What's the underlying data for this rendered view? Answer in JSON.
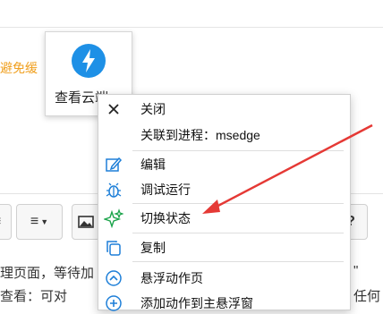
{
  "background": {
    "orange_text": "避免缓",
    "body_line1": "理页面，等待加",
    "body_line2": "查看：可对",
    "body_right1": "\"",
    "body_right2": "任何"
  },
  "toolbar": {
    "list_icon": "≡",
    "align_icon": "≡",
    "image_icon": "image-icon",
    "help_label": "?"
  },
  "tooltip": {
    "label": "查看云端",
    "icon": "lightning-bolt-icon",
    "accent": "#1e90e6"
  },
  "menu": {
    "items": [
      {
        "label": "关闭",
        "icon": "close-icon"
      },
      {
        "label": "关联到进程：msedge",
        "icon": ""
      },
      {
        "label": "编辑",
        "icon": "edit-icon"
      },
      {
        "label": "调试运行",
        "icon": "debug-icon"
      },
      {
        "label": "切换状态",
        "icon": "sparkle-icon"
      },
      {
        "label": "复制",
        "icon": "copy-icon"
      },
      {
        "label": "悬浮动作页",
        "icon": "float-page-icon"
      },
      {
        "label": "添加动作到主悬浮窗",
        "icon": "add-icon"
      }
    ],
    "icon_color": "#1e7fd8"
  },
  "annotation": {
    "arrow_color": "#e53935"
  }
}
